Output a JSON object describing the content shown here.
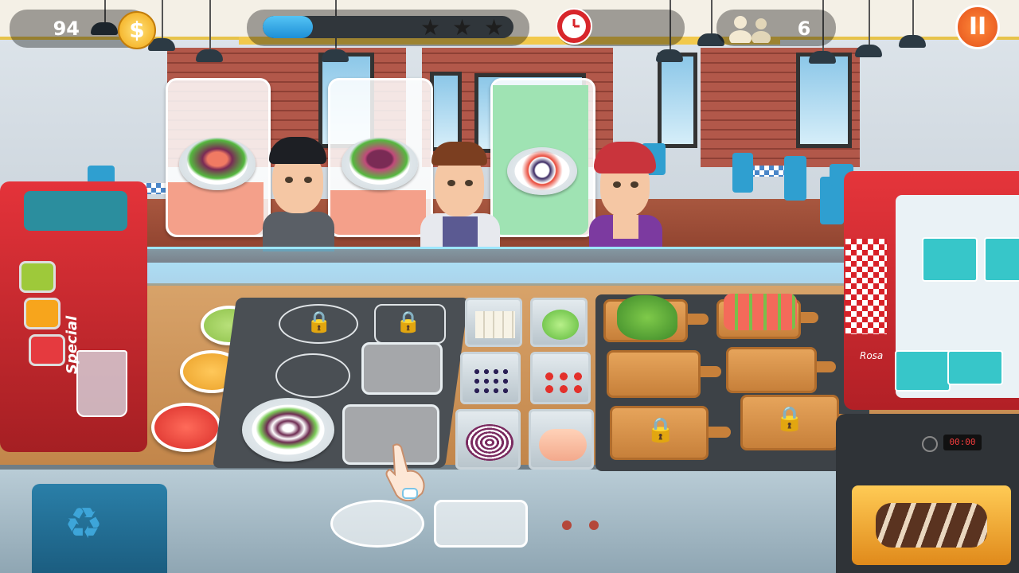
{
  "hud": {
    "coins": "94",
    "coin_icon": "$",
    "level_progress": 0.2,
    "stars_earned": 0,
    "stars_total": 3,
    "customers_remaining": "6",
    "pause_icon": "II"
  },
  "orders": [
    {
      "dish": "salmon-salad",
      "patience": 0.35,
      "patience_color": "#f4a08a"
    },
    {
      "dish": "onion-salad",
      "patience": 0.3,
      "patience_color": "#f4a08a"
    },
    {
      "dish": "greek-salad",
      "patience": 1.0,
      "patience_color": "#9fe3b3"
    }
  ],
  "juicer": {
    "brand": "Special",
    "buttons": [
      "lime-juice",
      "orange-juice",
      "strawberry-juice"
    ]
  },
  "fridge": {
    "brand": "Rosa"
  },
  "oven": {
    "display": "00:00"
  },
  "colors": {
    "accent": "#e4511b",
    "progress": "#1d8fd6",
    "counter": "#c08347"
  }
}
